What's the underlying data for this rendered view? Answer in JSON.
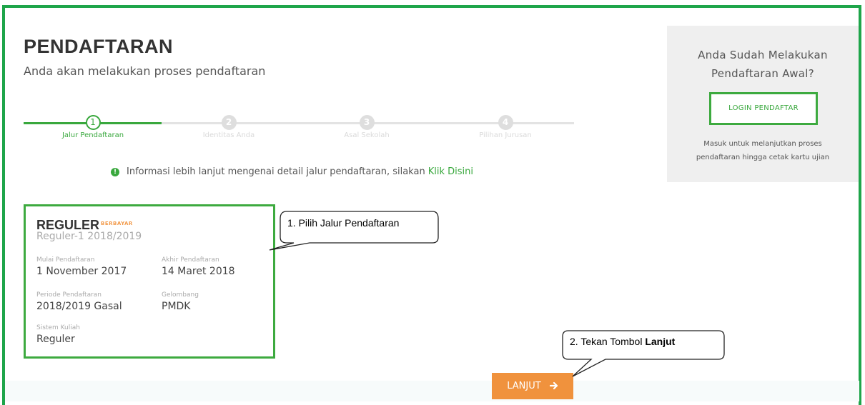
{
  "header": {
    "title": "PENDAFTARAN",
    "subtitle": "Anda akan melakukan proses pendaftaran"
  },
  "steps": [
    {
      "number": "1",
      "label": "Jalur Pendaftaran",
      "state": "active"
    },
    {
      "number": "2",
      "label": "Identitas Anda",
      "state": "inactive"
    },
    {
      "number": "3",
      "label": "Asal Sekolah",
      "state": "inactive"
    },
    {
      "number": "4",
      "label": "Pilihan Jurusan",
      "state": "inactive"
    }
  ],
  "info": {
    "icon": "info-circle-icon",
    "text": "Informasi lebih lanjut mengenai detail jalur pendaftaran, silakan",
    "link": "Klik Disini"
  },
  "card": {
    "name": "REGULER",
    "badge": "BERBAYAR",
    "subtitle": "Reguler-1 2018/2019",
    "fields": {
      "mulai": {
        "label": "Mulai Pendaftaran",
        "value": "1 November 2017"
      },
      "akhir": {
        "label": "Akhir Pendaftaran",
        "value": "14 Maret 2018"
      },
      "periode": {
        "label": "Periode Pendaftaran",
        "value": "2018/2019 Gasal"
      },
      "gelombang": {
        "label": "Gelombang",
        "value": "PMDK"
      },
      "sistem": {
        "label": "Sistem Kuliah",
        "value": "Reguler"
      }
    }
  },
  "sidebar": {
    "title_line1": "Anda Sudah Melakukan",
    "title_line2": "Pendaftaran Awal?",
    "login_label": "LOGIN PENDAFTAR",
    "desc_line1": "Masuk untuk melanjutkan proses",
    "desc_line2": "pendaftaran hingga cetak kartu ujian"
  },
  "actions": {
    "lanjut_label": "LANJUT",
    "lanjut_icon": "arrow-right-icon"
  },
  "callouts": {
    "one": "1.  Pilih Jalur Pendaftaran",
    "two_prefix": "2.  Tekan Tombol ",
    "two_bold": "Lanjut"
  },
  "colors": {
    "frame": "#1ea54a",
    "accent": "#39a83d",
    "button": "#f0923d",
    "badge": "#f29a4a"
  }
}
